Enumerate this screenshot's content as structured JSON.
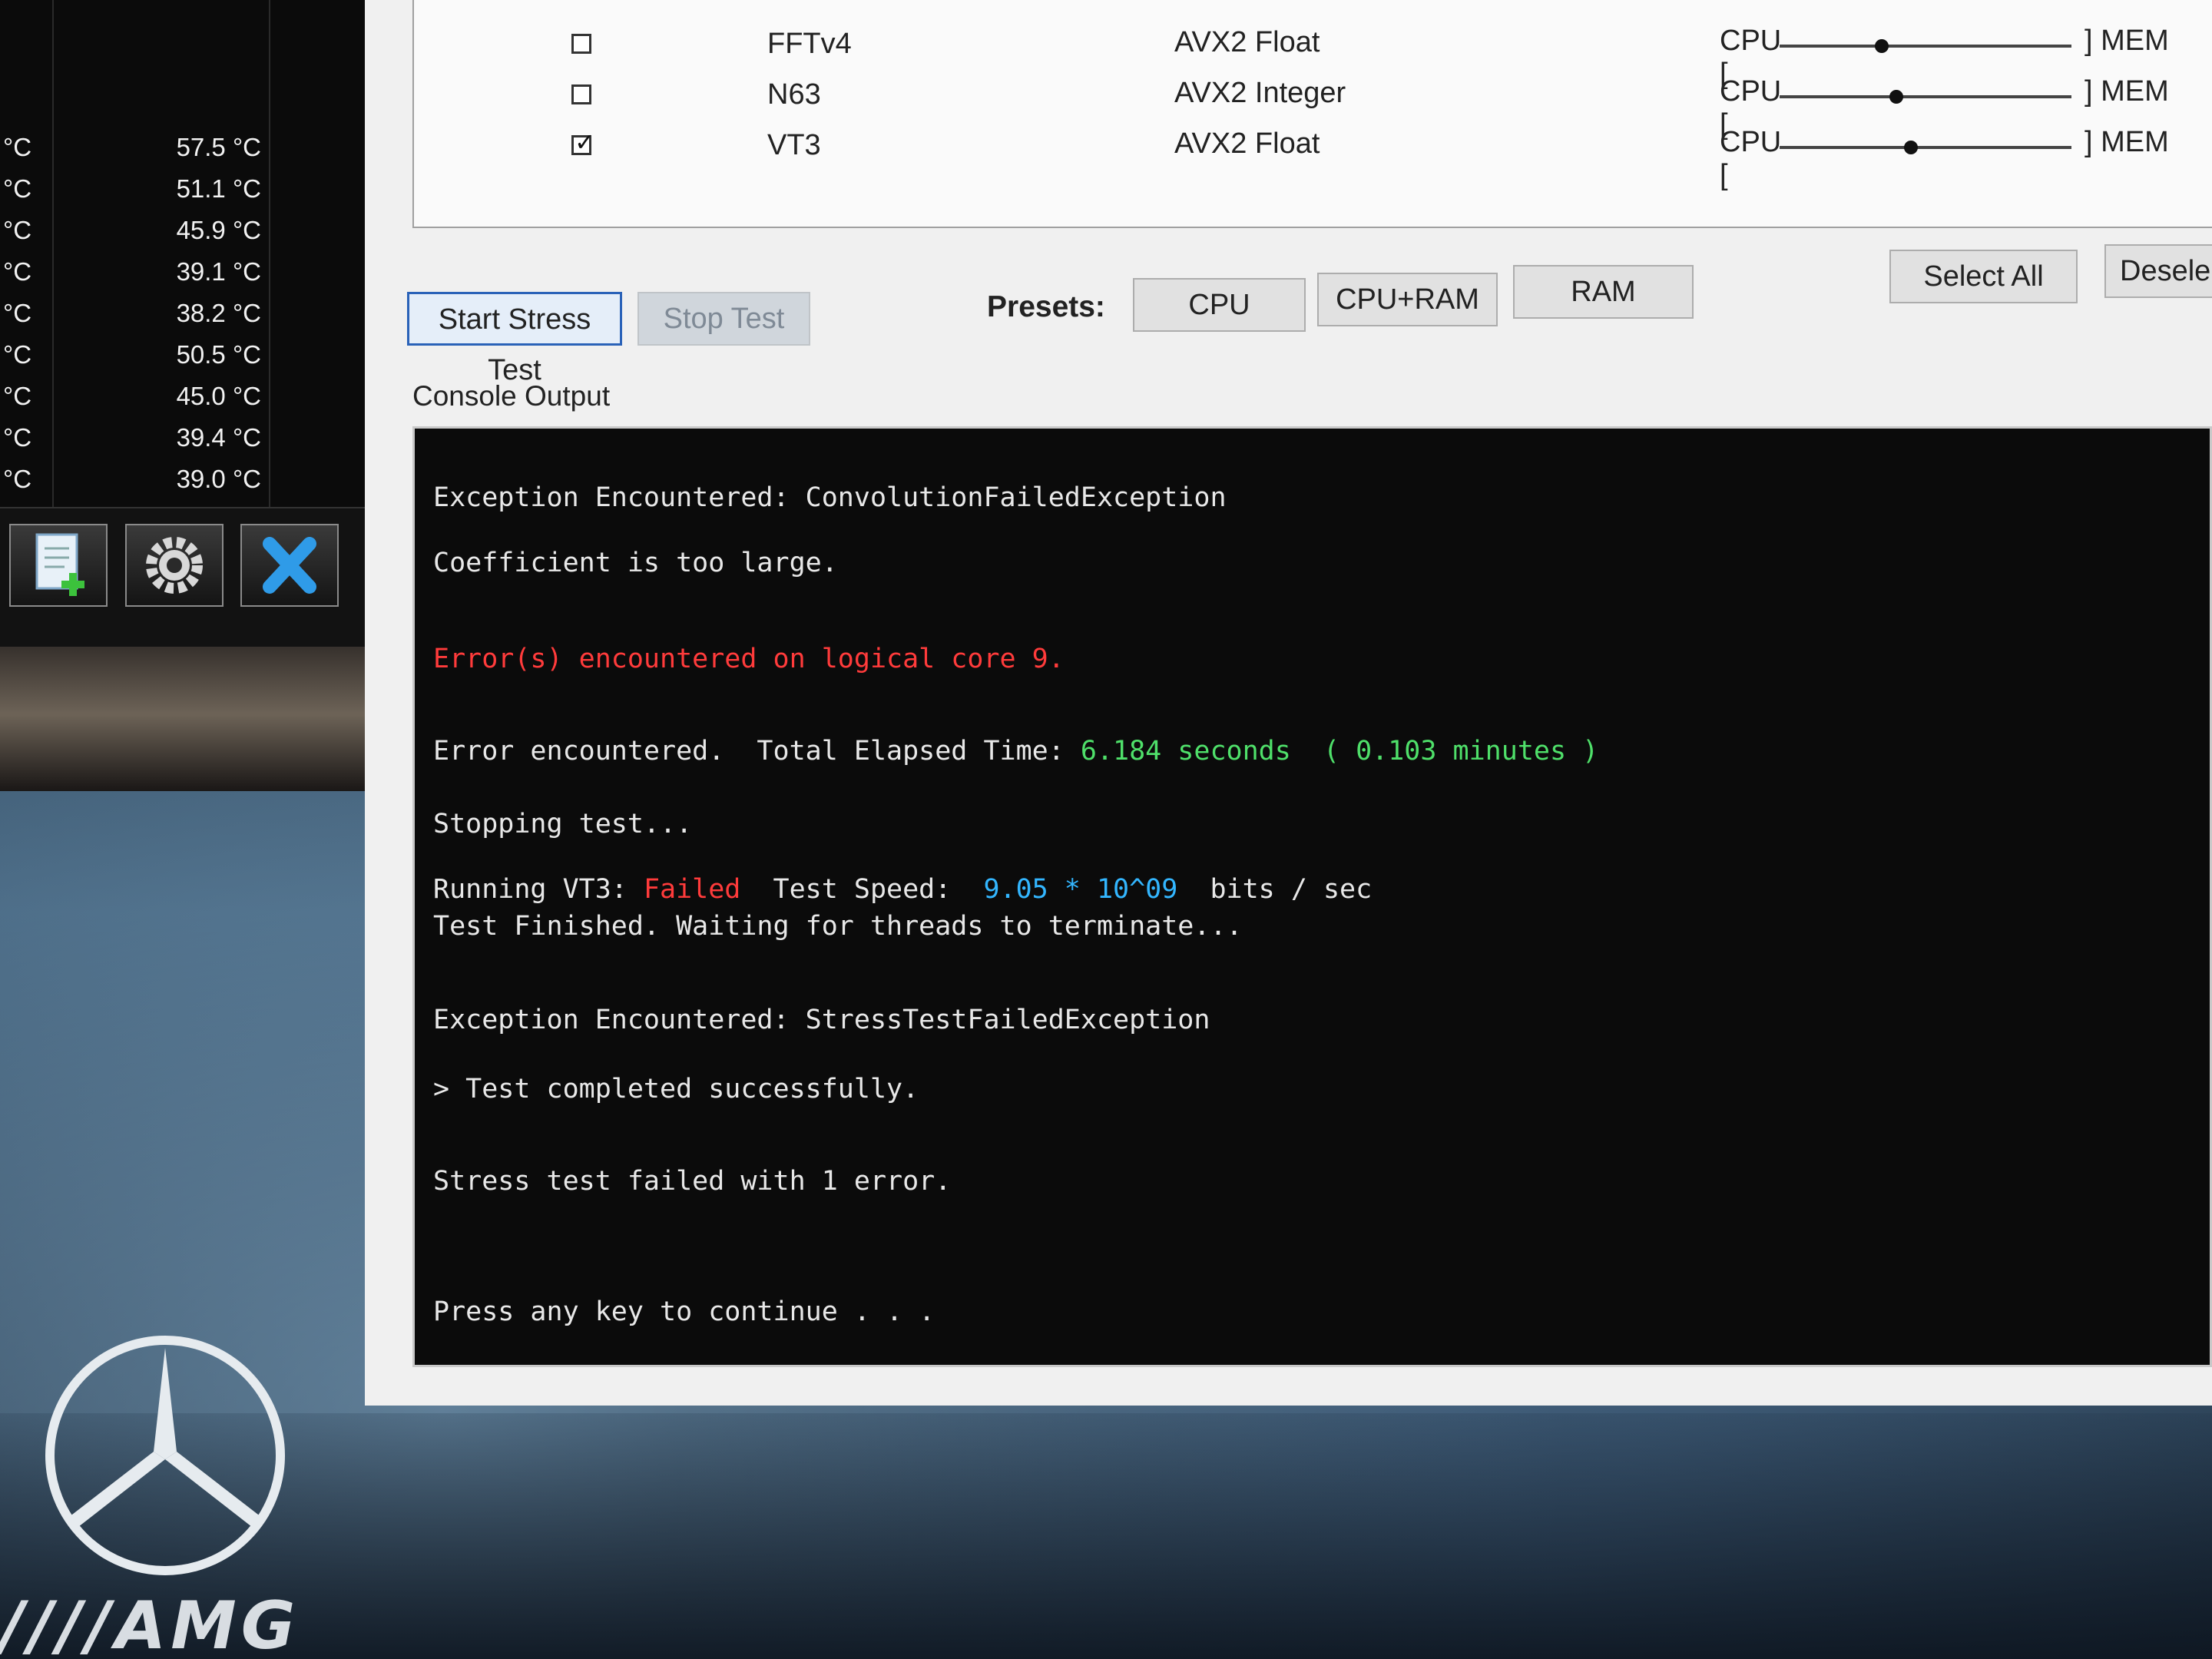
{
  "sensor_panel": {
    "rows": [
      {
        "unit": "°C",
        "value": "57.5 °C"
      },
      {
        "unit": "°C",
        "value": "51.1 °C"
      },
      {
        "unit": "°C",
        "value": "45.9 °C"
      },
      {
        "unit": "°C",
        "value": "39.1 °C"
      },
      {
        "unit": "°C",
        "value": "38.2 °C"
      },
      {
        "unit": "°C",
        "value": "50.5 °C"
      },
      {
        "unit": "°C",
        "value": "45.0 °C"
      },
      {
        "unit": "°C",
        "value": "39.4 °C"
      },
      {
        "unit": "°C",
        "value": "39.0 °C"
      }
    ],
    "toolbar_icons": [
      "add-log-file-icon",
      "settings-gear-icon",
      "close-x-icon"
    ]
  },
  "algorithms": {
    "rows": [
      {
        "checked": false,
        "name": "FFTv4",
        "type": "AVX2 Float",
        "cpu": "CPU [",
        "mem": "] MEM",
        "slider_level": 0.35
      },
      {
        "checked": false,
        "name": "N63",
        "type": "AVX2 Integer",
        "cpu": "CPU [",
        "mem": "] MEM",
        "slider_level": 0.4
      },
      {
        "checked": true,
        "name": "VT3",
        "type": "AVX2 Float",
        "cpu": "CPU [",
        "mem": "] MEM",
        "slider_level": 0.45
      }
    ]
  },
  "controls": {
    "start_label": "Start Stress Test",
    "stop_label": "Stop Test",
    "presets_label": "Presets:",
    "preset_cpu": "CPU",
    "preset_cpu_ram": "CPU+RAM",
    "preset_ram": "RAM",
    "select_all": "Select All",
    "deselect": "Desele"
  },
  "console": {
    "label": "Console Output",
    "l1": "Exception Encountered: ConvolutionFailedException",
    "l2": "Coefficient is too large.",
    "l3": "Error(s) encountered on logical core 9.",
    "l4a": "Error encountered.  Total Elapsed Time: ",
    "l4b": "6.184 seconds  ( 0.103 minutes )",
    "l5": "Stopping test...",
    "l6a": "Running VT3: ",
    "l6b": "Failed",
    "l6c": "  Test Speed:  ",
    "l6d": "9.05 * 10^09",
    "l6e": "  bits / sec",
    "l7": "Test Finished. Waiting for threads to terminate...",
    "l8": "Exception Encountered: StressTestFailedException",
    "l9": "> Test completed successfully.",
    "l10": "Stress test failed with 1 error.",
    "l11": "Press any key to continue . . ."
  },
  "wallpaper": {
    "brand": "AMG"
  }
}
